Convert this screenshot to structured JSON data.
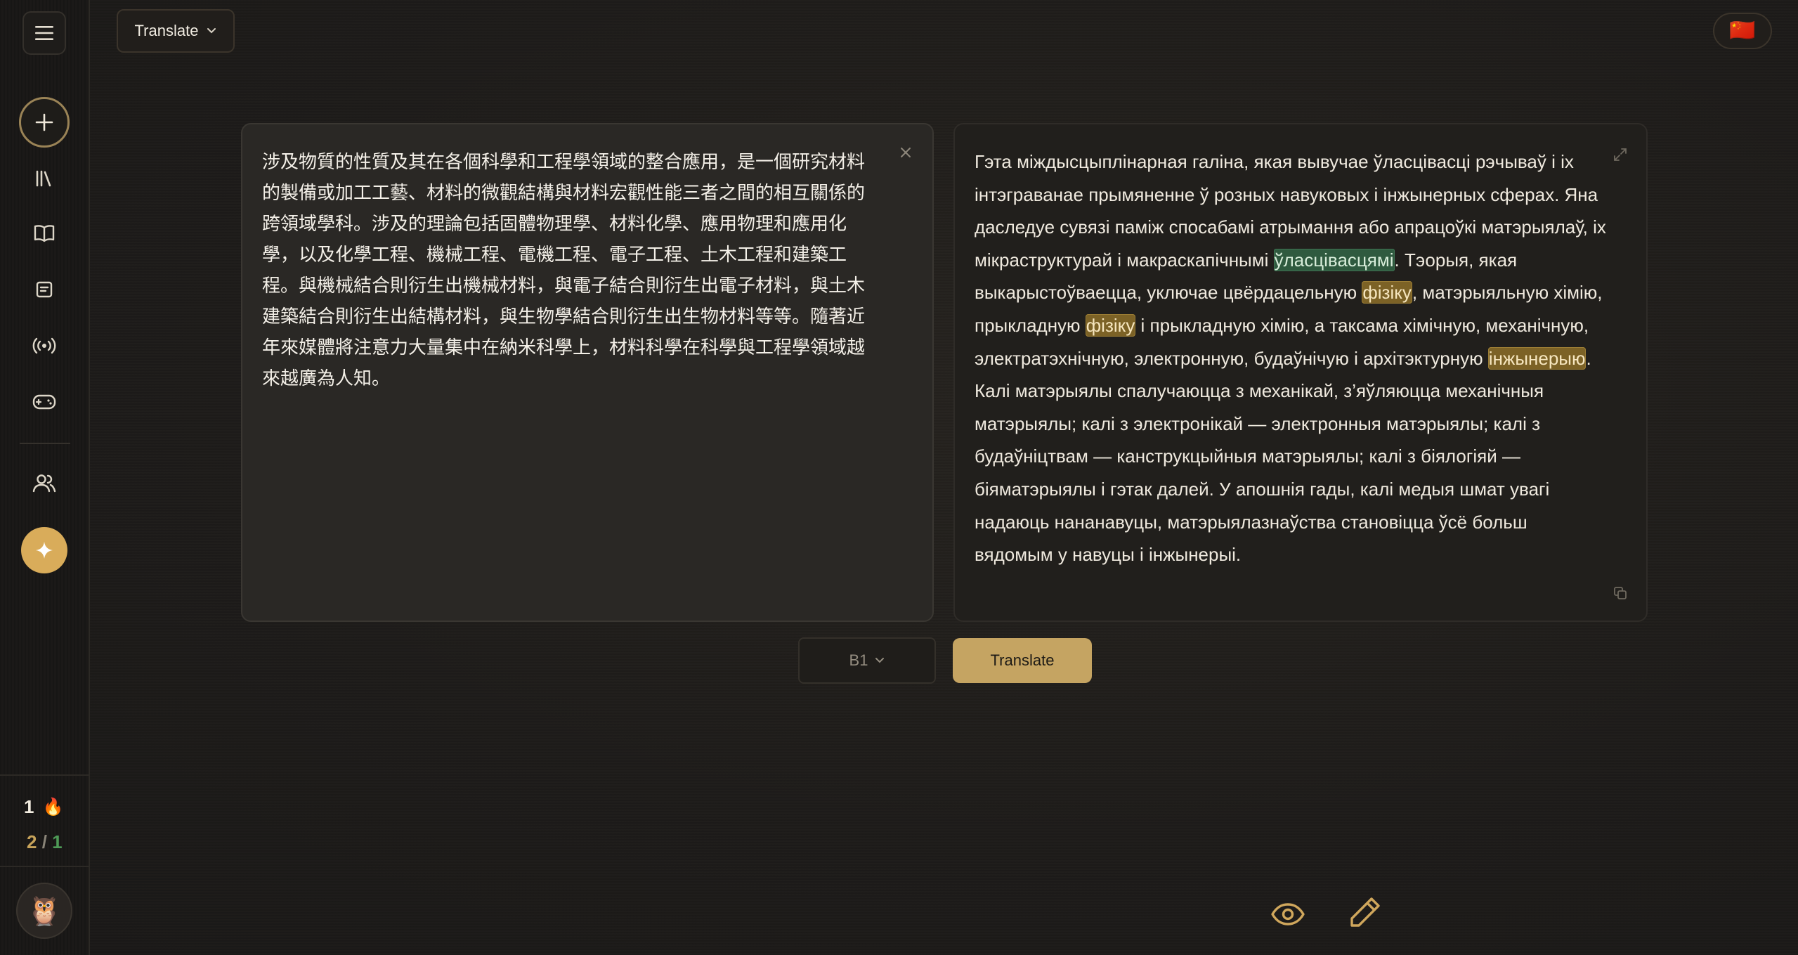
{
  "header": {
    "mode_label": "Translate",
    "language_flag": "🇨🇳"
  },
  "sidebar": {
    "items": [
      {
        "name": "library",
        "icon": "library-icon"
      },
      {
        "name": "book",
        "icon": "book-open-icon"
      },
      {
        "name": "notes",
        "icon": "note-icon"
      },
      {
        "name": "podcast",
        "icon": "broadcast-icon"
      },
      {
        "name": "games",
        "icon": "gamepad-icon"
      },
      {
        "name": "community",
        "icon": "users-icon"
      }
    ],
    "streak_count": "1",
    "streak_icon": "🔥",
    "progress_done": "2",
    "progress_sep": "/",
    "progress_total": "1",
    "avatar_icon": "🦉"
  },
  "source": {
    "text": "涉及物質的性質及其在各個科學和工程學領域的整合應用，是一個研究材料的製備或加工工藝、材料的微觀結構與材料宏觀性能三者之間的相互關係的跨領域學科。涉及的理論包括固體物理學、材料化學、應用物理和應用化學，以及化學工程、機械工程、電機工程、電子工程、土木工程和建築工程。與機械結合則衍生出機械材料，與電子結合則衍生出電子材料，與土木建築結合則衍生出結構材料，與生物學結合則衍生出生物材料等等。隨著近年來媒體將注意力大量集中在納米科學上，材料科學在科學與工程學領域越來越廣為人知。"
  },
  "target": {
    "seg1": "Гэта міждысцыплінарная галіна, якая вывучае ўласцівасці рэчываў і іх інтэграванае прымяненне ў розных навуковых і інжынерных сферах. Яна даследуе сувязі паміж спосабамі атрымання або апрацоўкі матэрыялаў, іх мікраструктурай і макраскапічнымі ",
    "hl1": "ўласцівасцямі",
    "seg2": ". Тэорыя, якая выкарыстоўваецца, уключае цвёрдацельную ",
    "hl2": "фізіку",
    "seg3": ", матэрыяльную хімію, прыкладную ",
    "hl3": "фізіку",
    "seg4": " і прыкладную хімію, а таксама хімічную, механічную, электратэхнічную, электронную, будаўнічую і архітэктурную ",
    "hl4": "інжынерыю",
    "seg5": ". Калі матэрыялы спалучаюцца з механікай, з’яўляюцца механічныя матэрыялы; калі з электронікай — электронныя матэрыялы; калі з будаўніцтвам — канструкцыйныя матэрыялы; калі з біялогіяй — біяматэрыялы і гэтак далей. У апошнія гады, калі медыя шмат увагі надаюць нананавуцы, матэрыялазнаўства становіцца ўсё больш вядомым у навуцы і інжынерыі."
  },
  "controls": {
    "level_value": "B1",
    "translate_label": "Translate"
  },
  "colors": {
    "accent": "#c5a462",
    "highlight_green": "#2f5a3f",
    "highlight_gold": "#7c6226"
  }
}
